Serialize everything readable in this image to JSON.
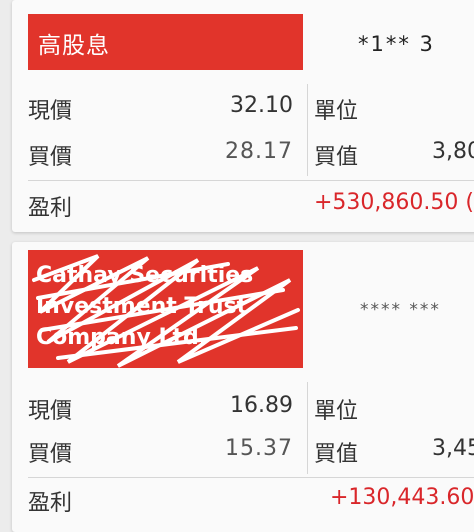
{
  "cards": [
    {
      "name": "高股息",
      "code": "*1** 3",
      "rows": {
        "price_label": "現價",
        "price_value": "32.10",
        "units_label": "單位",
        "units_value": "3,80",
        "cost_label": "買價",
        "cost_value": "28.17",
        "mv_label": "買值",
        "profit_label": "盈利",
        "profit_value": "+530,860.50 ("
      }
    },
    {
      "name_lines": [
        "Cathay Securities",
        "Investment Trust",
        "Company Ltd."
      ],
      "code": "**** ***",
      "rows": {
        "price_label": "現價",
        "price_value": "16.89",
        "units_label": "單位",
        "units_value": "3,45",
        "cost_label": "買價",
        "cost_value": "15.37",
        "mv_label": "買值",
        "profit_label": "盈利",
        "profit_value": "+130,443.60"
      }
    }
  ],
  "colors": {
    "banner": "#e1342b",
    "profit": "#d9262a",
    "background": "#ececec",
    "card": "#fafafa"
  }
}
